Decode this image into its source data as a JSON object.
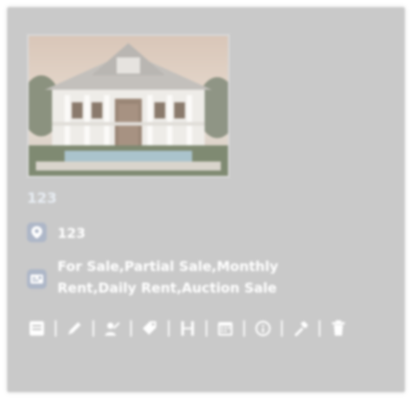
{
  "listing": {
    "id_label": "123",
    "address": "123",
    "sale_types": "For Sale,Partial Sale,Monthly Rent,Daily Rent,Auction Sale",
    "photo_alt": "House photo"
  },
  "colors": {
    "card_bg": "#c9c9c9",
    "id_text": "#e7ecf2",
    "text": "#ffffff",
    "chip_bg": "#aeb7c8"
  },
  "icons": {
    "address": "location-pin-icon",
    "sale_types": "sale-type-icon",
    "toolbar": [
      "view-icon",
      "edit-icon",
      "assign-user-icon",
      "tag-icon",
      "hotel-icon",
      "calendar-icon",
      "info-icon",
      "tools-icon",
      "delete-icon"
    ]
  }
}
